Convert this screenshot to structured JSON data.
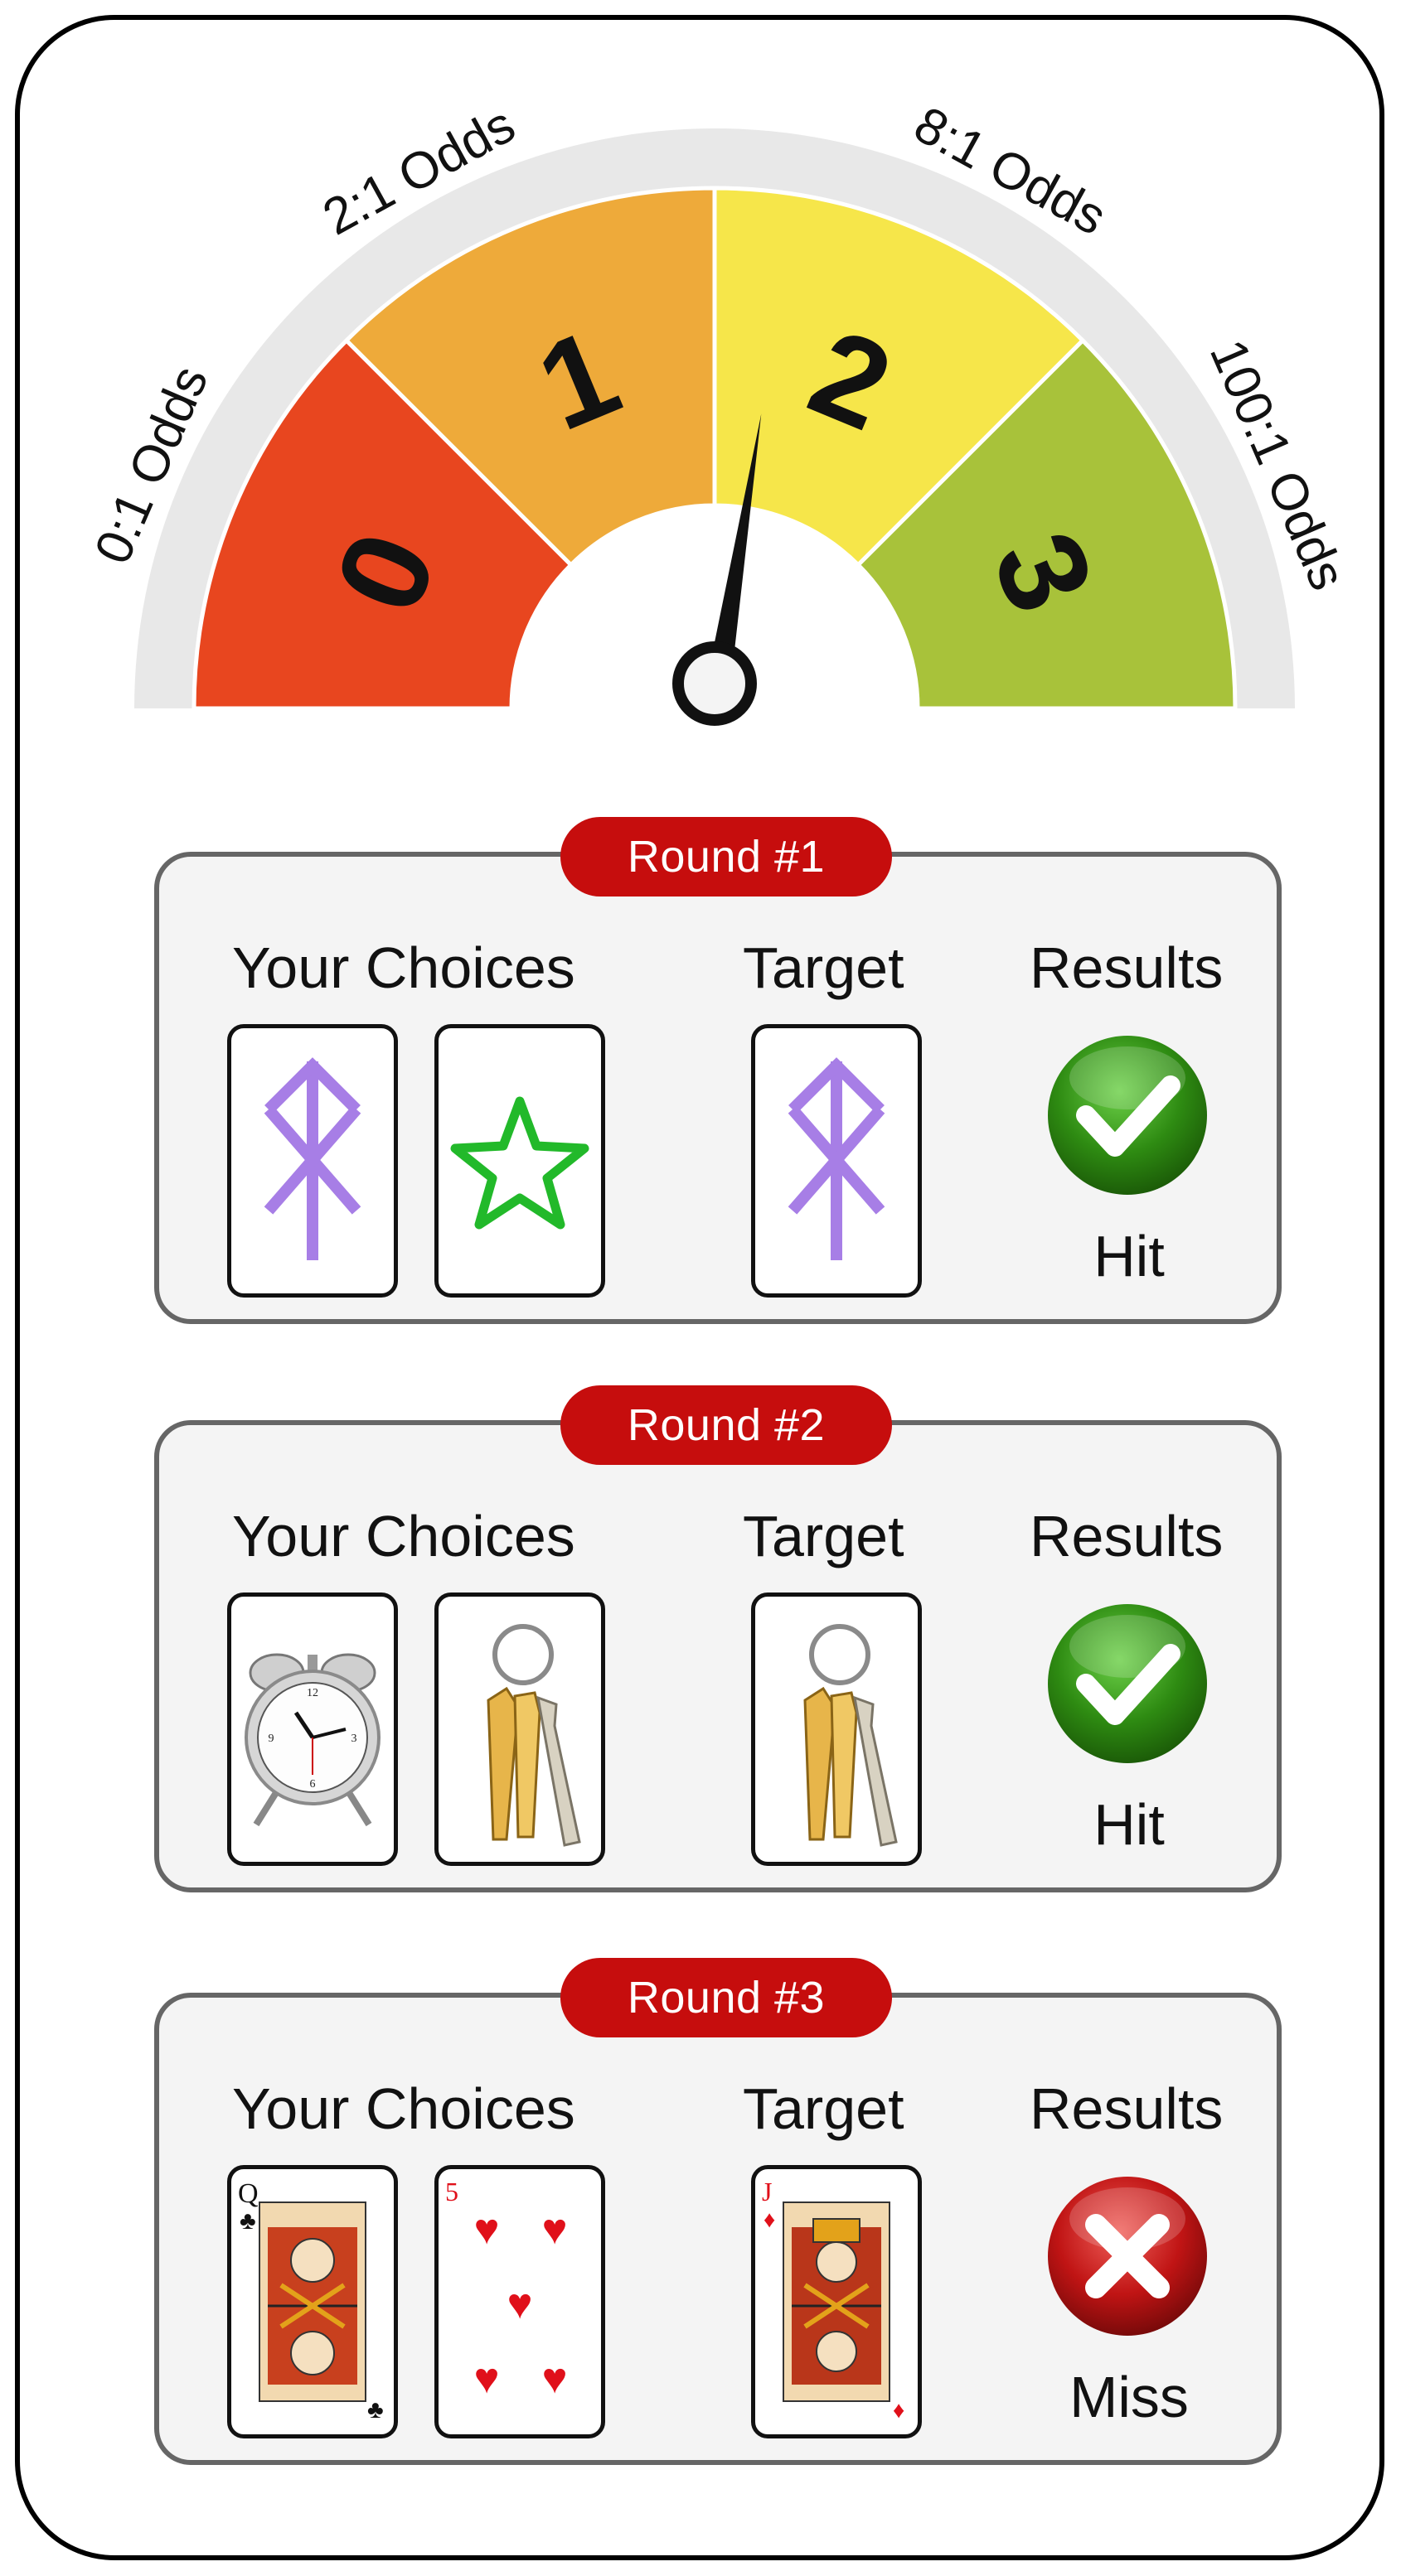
{
  "gauge": {
    "value": 2,
    "segments": [
      {
        "label": "0",
        "color": "#e8461f"
      },
      {
        "label": "1",
        "color": "#eeaa3a"
      },
      {
        "label": "2",
        "color": "#f6e64a"
      },
      {
        "label": "3",
        "color": "#a8c23a"
      }
    ],
    "odds_labels": [
      "0:1 Odds",
      "2:1 Odds",
      "8:1 Odds",
      "100:1 Odds"
    ]
  },
  "sections": {
    "choices_label": "Your Choices",
    "target_label": "Target",
    "results_label": "Results"
  },
  "rounds": [
    {
      "title": "Round #1",
      "result": "Hit",
      "result_icon": "check-icon",
      "choices": [
        "rune-icon",
        "star-icon"
      ],
      "target": "rune-icon"
    },
    {
      "title": "Round #2",
      "result": "Hit",
      "result_icon": "check-icon",
      "choices": [
        "alarm-clock-icon",
        "keys-icon"
      ],
      "target": "keys-icon"
    },
    {
      "title": "Round #3",
      "result": "Miss",
      "result_icon": "x-icon",
      "choices": [
        "queen-of-clubs-card",
        "five-of-hearts-card"
      ],
      "target": "jack-of-diamonds-card",
      "card_corners": {
        "queen": "Q",
        "five": "5",
        "jack": "J"
      }
    }
  ],
  "colors": {
    "round_pill": "#c60d0d",
    "hit": "#2e8b12",
    "miss": "#c01414",
    "rune": "#a77ee6",
    "star": "#22b92a"
  }
}
